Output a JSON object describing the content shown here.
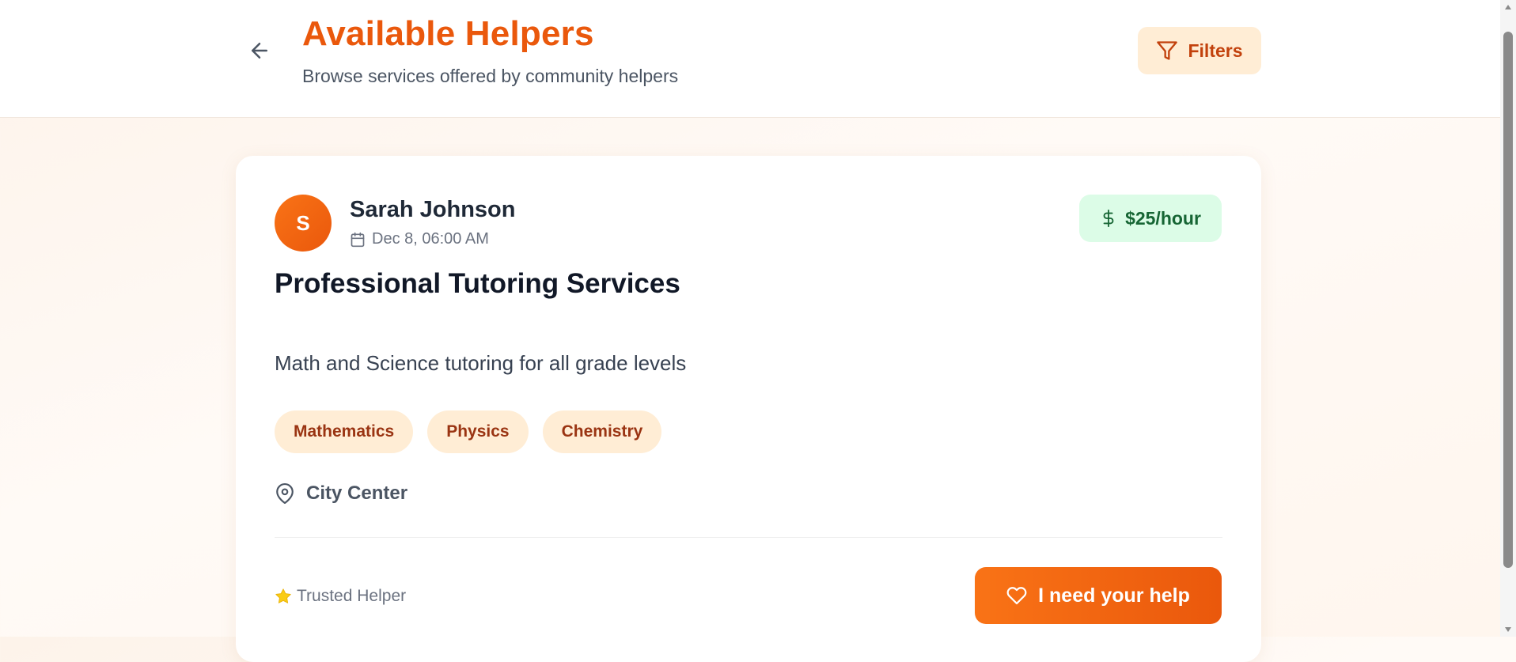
{
  "header": {
    "title": "Available Helpers",
    "subtitle": "Browse services offered by community helpers",
    "back_icon": "arrow-left-icon",
    "filters_label": "Filters",
    "filters_icon": "funnel-icon"
  },
  "card": {
    "avatar_initial": "S",
    "helper_name": "Sarah Johnson",
    "date": "Dec 8, 06:00 AM",
    "price": "$25/hour",
    "service_title": "Professional Tutoring Services",
    "description": "Math and Science tutoring for all grade levels",
    "tags": [
      "Mathematics",
      "Physics",
      "Chemistry"
    ],
    "location": "City Center",
    "trusted_label": "Trusted Helper",
    "help_button_label": "I need your help"
  },
  "colors": {
    "accent": "#ea580c",
    "accent_light": "#ffedd5",
    "price_bg": "#dcfce7",
    "price_text": "#166534",
    "star": "#facc15"
  }
}
